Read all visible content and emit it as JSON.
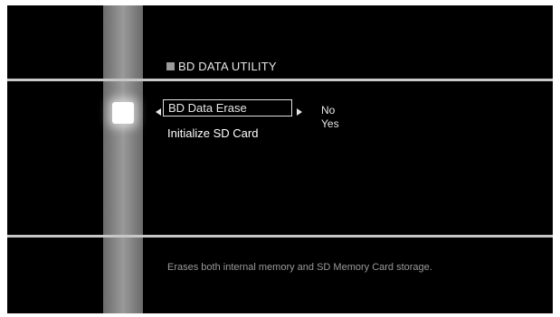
{
  "screen": {
    "title": "BD DATA UTILITY",
    "menu": {
      "items": [
        {
          "label": "BD Data Erase"
        },
        {
          "label": "Initialize SD Card"
        }
      ],
      "selected_index": 0
    },
    "options": {
      "items": [
        {
          "label": "No"
        },
        {
          "label": "Yes"
        }
      ]
    },
    "description": "Erases both internal memory and SD Memory Card storage."
  },
  "colors": {
    "background": "#000000",
    "divider": "#c8c8c8",
    "side_strip": "#8a8a8a",
    "text_primary": "#e6e6e6",
    "text_secondary": "#9a9a9a"
  }
}
